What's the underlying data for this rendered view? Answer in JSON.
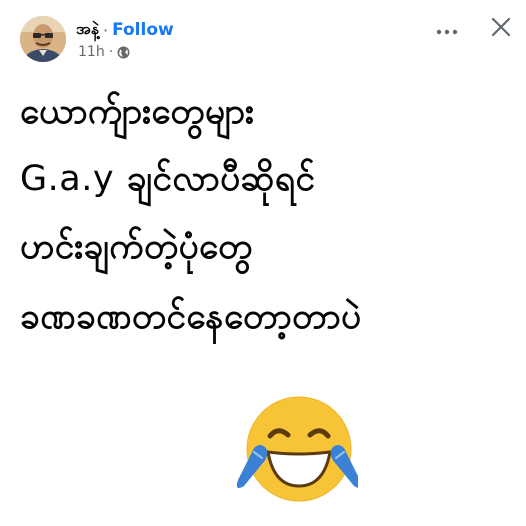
{
  "post": {
    "author_name": "အနဲ့",
    "separator": "·",
    "follow_label": "Follow",
    "time": "11h",
    "meta_separator": "·",
    "privacy_icon": "globe-icon"
  },
  "header_actions": {
    "more_icon": "more-horizontal-icon",
    "more_glyph": "•••",
    "close_icon": "close-icon"
  },
  "content": {
    "line1": "ယောက်ျားတွေများ",
    "line2_latin": "G.a.y",
    "line2_rest": " ချင်လာပီဆိုရင်",
    "line3": "ဟင်းချက်တဲ့ပုံတွေ",
    "line4": "ခဏခဏတင်နေတော့တာပဲ",
    "emoji": "face-with-tears-of-joy"
  },
  "colors": {
    "follow": "#1877f2",
    "text": "#050505",
    "muted": "#65676b",
    "emoji_face": "#f7c437",
    "emoji_tears": "#3b82d6"
  }
}
